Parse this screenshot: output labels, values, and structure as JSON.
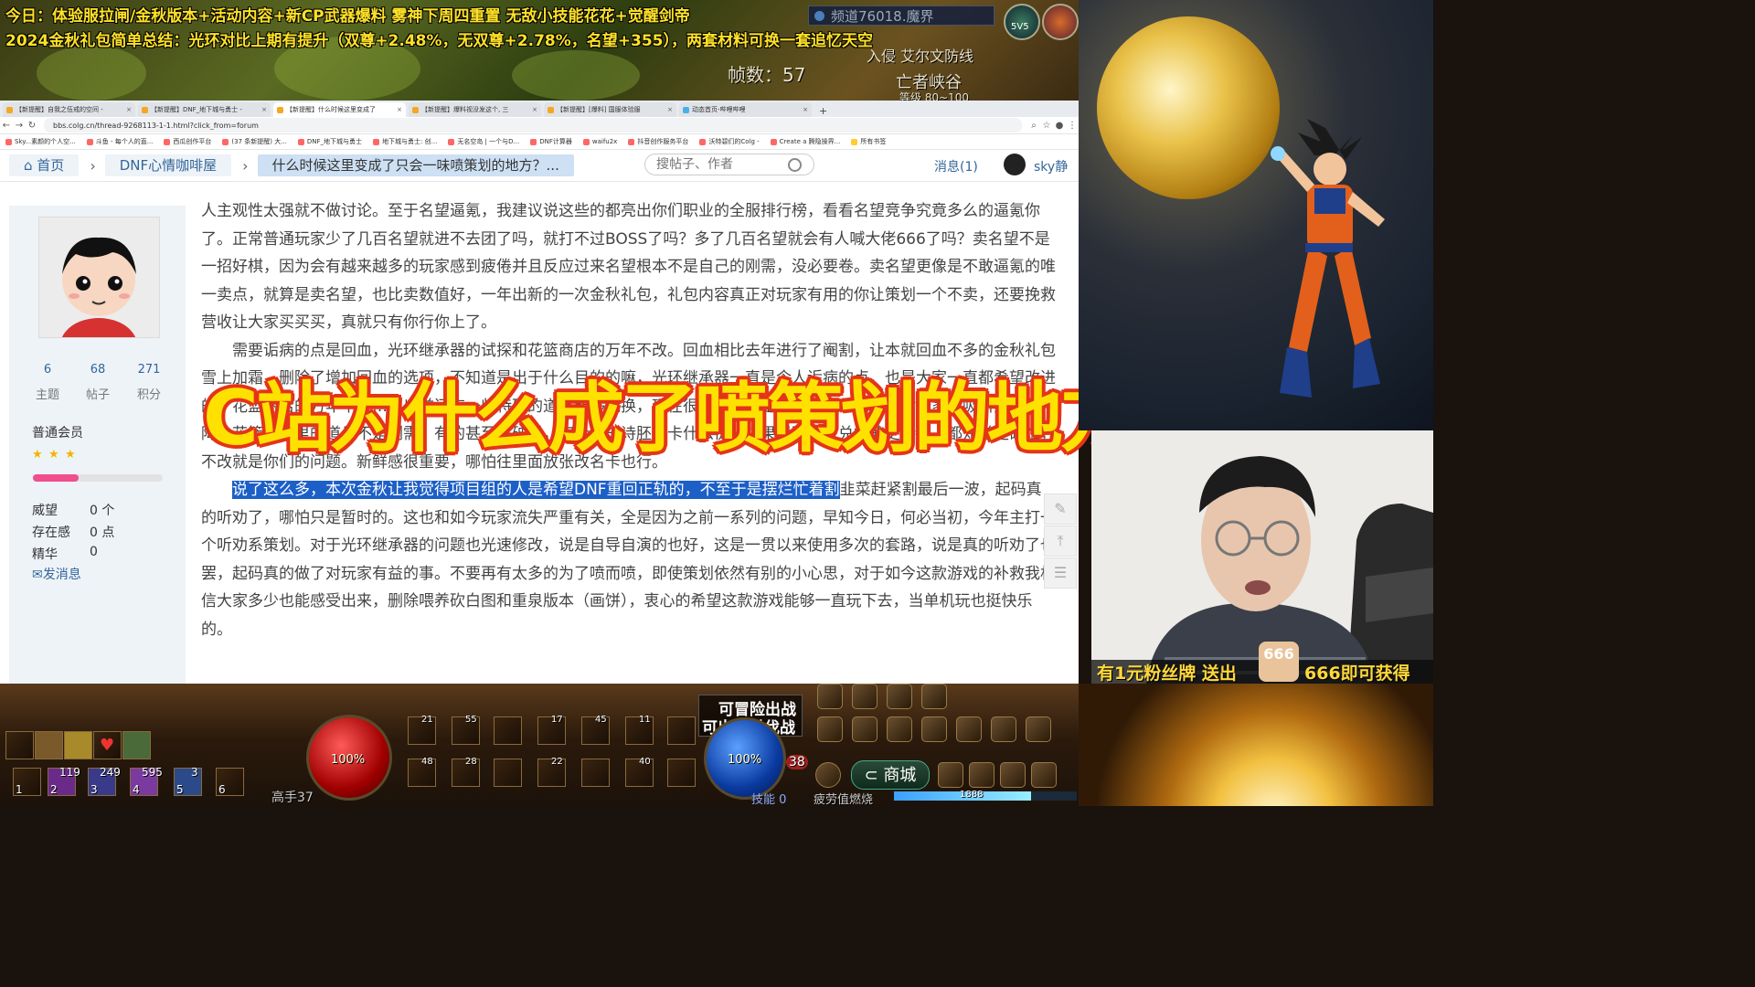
{
  "stream": {
    "line1": "今日：体验服拉闸/金秋版本+活动内容+新CP武器爆料  雾神下周四重置  无敌小技能花花+觉醒剑帝",
    "line2": "2024金秋礼包简单总结：光环对比上期有提升（双尊+2.48%，无双尊+2.78%，名望+355），两套材料可换一套追忆天空",
    "big_title": "C站为什么成了喷策划的地方",
    "fan_left": "有1元粉丝牌 送出",
    "fan_right": "666即可获得",
    "fan_badge": "666"
  },
  "game_top": {
    "channel": "频道76018.魔界",
    "fps": "帧数：57",
    "map1": "入侵 艾尔文防线",
    "map2": "亡者峡谷",
    "map3": "等级 80~100",
    "badge": "5V5"
  },
  "browser": {
    "tabs": [
      "【新提醒】自我之伍戒的空间 -",
      "【新提醒】DNF_地下城与勇士 -",
      "【新提醒】什么时候这里变成了",
      "【新提醒】爆料视没发这个, 三",
      "【新提醒】[爆料] 国服体验服",
      "动态首页-哔哩哔哩"
    ],
    "new_tab": "+",
    "url": "bbs.colg.cn/thread-9268113-1-1.html?click_from=forum",
    "bookmarks": [
      "Sky...素颜的个人空...",
      "斗鱼 - 每个人的直...",
      "西瓜创作平台",
      "(37 条新提醒) 大...",
      "DNF_地下城与勇士",
      "地下城与勇士: 创...",
      "无名空岛 | 一个与D...",
      "DNF计算器",
      "waifu2x",
      "抖音创作服务平台",
      "沃特碧们的Colg -",
      "Create a 腾隐操界...",
      "所有书签"
    ]
  },
  "forum": {
    "home": "首页",
    "board": "DNF心情咖啡屋",
    "thread_title": "什么时候这里变成了只会一味喷策划的地方？...",
    "search_placeholder": "搜帖子、作者",
    "messages": "消息(1)",
    "username": "sky静"
  },
  "profile": {
    "stats": [
      {
        "num": "6",
        "label": "主题"
      },
      {
        "num": "68",
        "label": "帖子"
      },
      {
        "num": "271",
        "label": "积分"
      }
    ],
    "group": "普通会员",
    "level_progress": 0.35,
    "prestige_label": "威望",
    "prestige_value": "0 个",
    "presence_label": "存在感",
    "presence_value": "0 点",
    "essence_label": "精华",
    "essence_value": "0",
    "send_message": "发消息"
  },
  "post": {
    "p1": "人主观性太强就不做讨论。至于名望逼氪，我建议说这些的都亮出你们职业的全服排行榜，看看名望竞争究竟多么的逼氪你了。正常普通玩家少了几百名望就进不去团了吗，就打不过BOSS了吗？多了几百名望就会有人喊大佬666了吗？卖名望不是一招好棋，因为会有越来越多的玩家感到疲倦并且反应过来名望根本不是自己的刚需，没必要卷。卖名望更像是不敢逼氪的唯一卖点，就算是卖名望，也比卖数值好，一年出新的一次金秋礼包，礼包内容真正对玩家有用的你让策划一个不卖，还要挽救营收让大家买买买，真就只有你行你上了。",
    "p2": "需要诟病的点是回血，光环继承器的试探和花篮商店的万年不改。回血相比去年进行了阉割，让本就回血不多的金秋礼包雪上加霜，删除了增加回血的选项，不知道是出于什么目的的嘛，光环继承器一直是令人诟病的点，也是大家一直都希望改进的，花篮商店的万年不改……以前还有一些特殊的道具能够兑换，现在很多兑换都是变成了年年如此，对玩家的吸引力逐年下降。花篮商店里的道具不是刚需，有的甚至是破烂，如今的史诗胚子卡什么价，结果里面还有兑换的史诗卡，都知道是破烂，不改就是你们的问题。新鲜感很重要，哪怕往里面放张改名卡也行。",
    "p3_highlight": "说了这么多，本次金秋让我觉得项目组的人是希望DNF重回正轨的，不至于是摆烂忙着割",
    "p3_rest": "韭菜赶紧割最后一波，起码真的听劝了，哪怕只是暂时的。这也和如今玩家流失严重有关，全是因为之前一系列的问题，早知今日，何必当初，今年主打一个听劝系策划。对于光环继承器的问题也光速修改，说是自导自演的也好，这是一贯以来使用多次的套路，说是真的听劝了也罢，起码真的做了对玩家有益的事。不要再有太多的为了喷而喷，即使策划依然有别的小心思，对于如今这款游戏的补救我相信大家多少也能感受出来，删除喂养砍白图和重泉版本（画饼），衷心的希望这款游戏能够一直玩下去，当单机玩也挺快乐的。"
  },
  "hud": {
    "hp": "100%",
    "mp": "100%",
    "adventure_line1": "可冒险出战",
    "adventure_line2": "可出战讨伐战",
    "shop": "商城",
    "skill_label": "技能",
    "skill_points": "0",
    "player_title": "高手37",
    "status_text": "疲劳值燃烧",
    "exp_progress": 0.75,
    "level_badge": "38",
    "slot_numbers": [
      "119",
      "249",
      "595",
      "3"
    ],
    "quick_keys": [
      "1",
      "2",
      "3",
      "4",
      "5",
      "6"
    ],
    "skill_keys": [
      "21",
      "55",
      "17",
      "45",
      "11",
      "48",
      "28",
      "22",
      "40",
      "38"
    ],
    "exp_text": "1888"
  },
  "colors": {
    "overlay_yellow": "#ffe227",
    "title_fill": "#ffe100",
    "title_outline": "#e53418",
    "link_blue": "#336699",
    "highlight": "#1c5fc7"
  }
}
